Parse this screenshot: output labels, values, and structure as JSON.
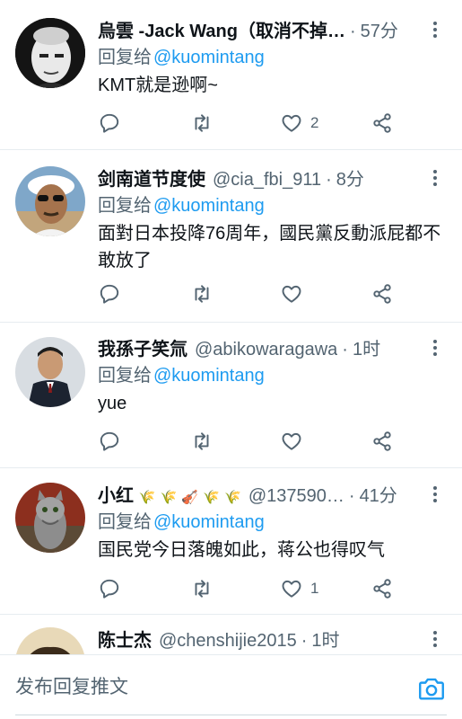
{
  "reply_prefix": "回复给",
  "tweets": [
    {
      "name": "烏雲 -Jack Wang（取消不掉…",
      "handle": "",
      "time": "57分",
      "reply_to": "@kuomintang",
      "text": "KMT就是逊啊~",
      "counts": {
        "reply": "",
        "retweet": "",
        "like": "2"
      }
    },
    {
      "name": "剑南道节度使",
      "handle": "@cia_fbi_911",
      "time": "8分",
      "reply_to": "@kuomintang",
      "text": "面對日本投降76周年，國民黨反動派屁都不敢放了",
      "counts": {
        "reply": "",
        "retweet": "",
        "like": ""
      }
    },
    {
      "name": "我孫子笑氚",
      "handle": "@abikowaragawa",
      "time": "1时",
      "reply_to": "@kuomintang",
      "text": "yue",
      "counts": {
        "reply": "",
        "retweet": "",
        "like": ""
      }
    },
    {
      "name": "小红",
      "name_emoji": "🌾 🌾 🎻 🌾 🌾",
      "handle": "@137590…",
      "time": "41分",
      "reply_to": "@kuomintang",
      "text": "国民党今日落魄如此，蒋公也得叹气",
      "counts": {
        "reply": "",
        "retweet": "",
        "like": "1"
      }
    },
    {
      "name": "陈士杰",
      "handle": "@chenshijie2015",
      "time": "1时"
    }
  ],
  "composer": {
    "placeholder": "发布回复推文"
  },
  "colors": {
    "accent": "#1d9bf0",
    "secondary_text": "#536471",
    "divider": "#e6ecf0"
  },
  "icons": [
    "reply-icon",
    "retweet-icon",
    "like-icon",
    "share-icon",
    "more-icon",
    "camera-icon"
  ]
}
